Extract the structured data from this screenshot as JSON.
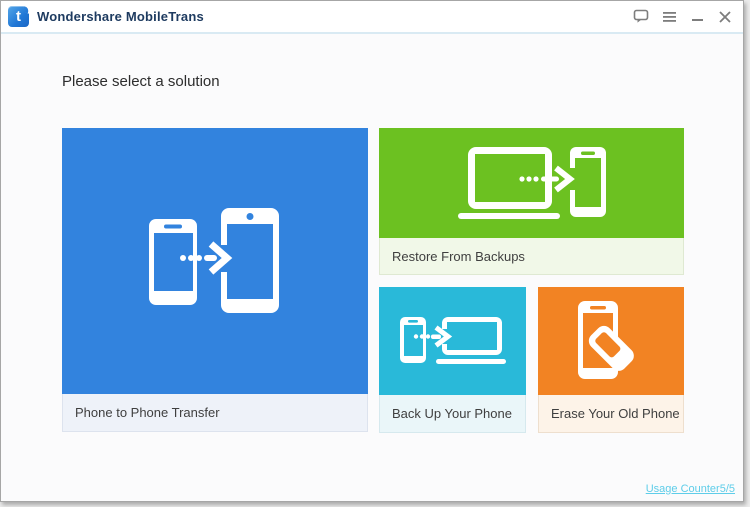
{
  "app": {
    "title": "Wondershare MobileTrans",
    "logo_letter": "t"
  },
  "titlebar": {
    "controls": [
      {
        "name": "feedback",
        "icon": "speech-bubble-icon"
      },
      {
        "name": "menu",
        "icon": "hamburger-icon"
      },
      {
        "name": "minimize",
        "icon": "minimize-icon"
      },
      {
        "name": "close",
        "icon": "close-icon"
      }
    ]
  },
  "heading": "Please select a solution",
  "tiles": [
    {
      "label": "Phone to Phone Transfer",
      "icon": "phone-to-phone-icon",
      "color": "#3283de",
      "label_bg": "#eef2f9"
    },
    {
      "label": "Restore From Backups",
      "icon": "computer-to-phone-icon",
      "color": "#6cc121",
      "label_bg": "#f1f8e8"
    },
    {
      "label": "Back Up Your Phone",
      "icon": "phone-to-computer-icon",
      "color": "#29b9d9",
      "label_bg": "#eaf6f9"
    },
    {
      "label": "Erase Your Old Phone",
      "icon": "phone-eraser-icon",
      "color": "#f28323",
      "label_bg": "#fdf3e8"
    }
  ],
  "footer": {
    "usage_counter": "Usage Counter5/5",
    "link_color": "#5ecde9"
  }
}
